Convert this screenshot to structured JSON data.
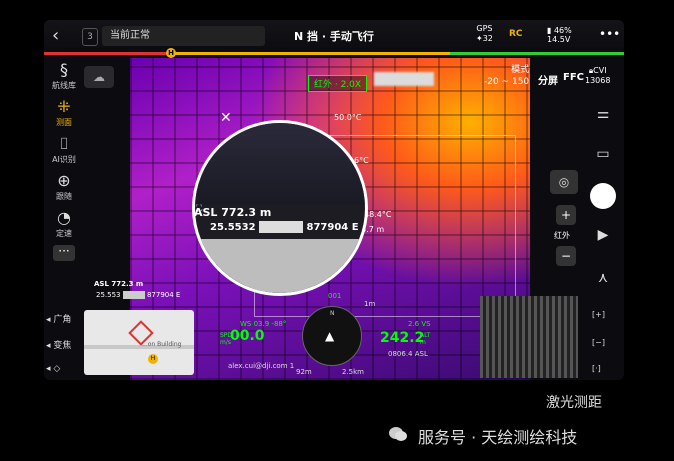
{
  "topbar": {
    "badge": "3",
    "status": "当前正常",
    "mode": "N 挡 · 手动飞行",
    "gps_label": "GPS",
    "gps_count": "32",
    "rc_label": "RC",
    "battery_pct": "46%",
    "battery_voltage": "14.5V",
    "more": "•••"
  },
  "left_tools": [
    {
      "label": "航线库",
      "icon": "route-icon"
    },
    {
      "label": "测面",
      "icon": "measure-icon"
    },
    {
      "label": "AI识别",
      "icon": "ai-icon"
    },
    {
      "label": "跟随",
      "icon": "follow-icon"
    },
    {
      "label": "定速",
      "icon": "speed-icon"
    }
  ],
  "left_labels": {
    "wide": "广角",
    "zoom": "变焦"
  },
  "overlay": {
    "ir_tag": "红外 · 2.0X",
    "mode_title": "模式",
    "mode_range": "-20 ~ 150",
    "split": "分屏",
    "ffc": "FFC",
    "cvi_label": "CVI",
    "cvi_value": "13068",
    "temp_1": "50.0°C",
    "temp_2": "…6°C",
    "temp_3": "48.4°C",
    "dist_tag": "33.7 m",
    "asl_big": "ASL 772.3 m",
    "coord_big_a": "25.5532",
    "coord_big_b": "877904 E",
    "asl_small": "ASL 772.3 m",
    "coord_small_a": "25.553",
    "coord_small_b": "877904 E",
    "minimap_label": "...on Building"
  },
  "telemetry": {
    "ws": "WS 03.9",
    "ws_angle": "-88°",
    "spd_label": "SPD",
    "spd_unit": "m/s",
    "spd_value": "00.0",
    "email": "alex.cui@dji.com 1",
    "heading": "001",
    "dist_home": "92m",
    "dist_total": "2.5km",
    "one_m": "1m",
    "vs": "2.6 VS",
    "alt_value": "242.2",
    "alt_label": "ALT",
    "alt_unit": "m",
    "asl": "0806.4 ASL"
  },
  "right": {
    "ir_label": "红外",
    "plus": "+",
    "minus": "−",
    "idx_plus": "[+]",
    "idx_minus": "[−]",
    "idx_dot": "[·]"
  },
  "caption": "激光测距",
  "footer": "服务号 · 天绘测绘科技"
}
